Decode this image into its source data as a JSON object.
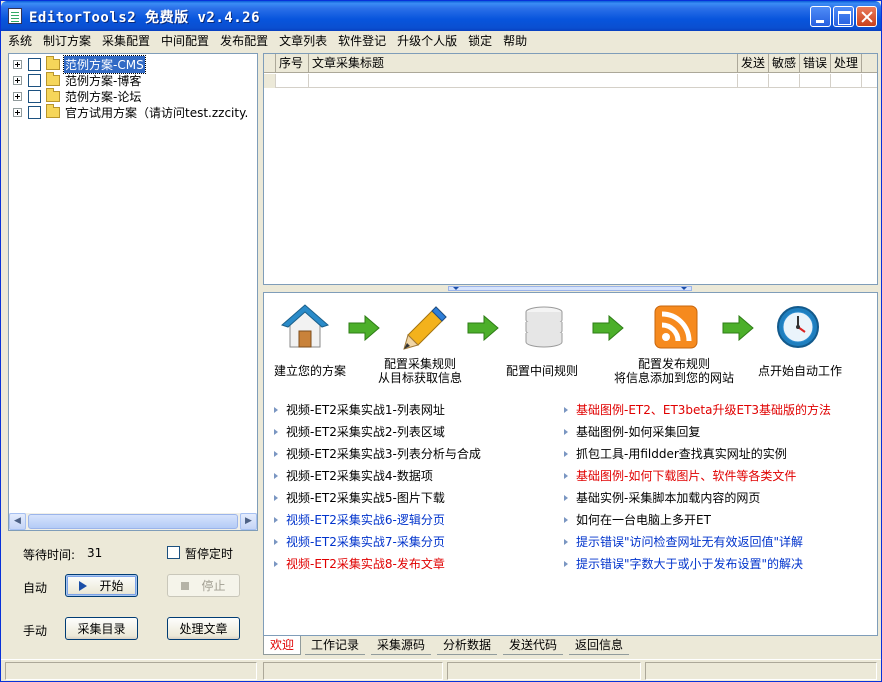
{
  "window": {
    "title": "EditorTools2 免费版 v2.4.26"
  },
  "menu": [
    "系统",
    "制订方案",
    "采集配置",
    "中间配置",
    "发布配置",
    "文章列表",
    "软件登记",
    "升级个人版",
    "锁定",
    "帮助"
  ],
  "tree": [
    {
      "label": "范例方案-CMS",
      "selected": true
    },
    {
      "label": "范例方案-博客",
      "selected": false
    },
    {
      "label": "范例方案-论坛",
      "selected": false
    },
    {
      "label": "官方试用方案（请访问test.zzcity.",
      "selected": false
    }
  ],
  "left_panel": {
    "wait_label": "等待时间:",
    "wait_value": "31",
    "pause_label": "暂停定时",
    "auto_label": "自动",
    "start_label": "开始",
    "stop_label": "停止",
    "manual_label": "手动",
    "collect_dir_label": "采集目录",
    "process_article_label": "处理文章"
  },
  "grid": {
    "columns": [
      "序号",
      "文章采集标题",
      "发送",
      "敏感",
      "错误",
      "处理"
    ]
  },
  "steps": [
    {
      "icon": "house-icon",
      "line1": "建立您的方案",
      "line2": ""
    },
    {
      "icon": "pencil-icon",
      "line1": "配置采集规则",
      "line2": "从目标获取信息"
    },
    {
      "icon": "database-icon",
      "line1": "配置中间规则",
      "line2": ""
    },
    {
      "icon": "rss-icon",
      "line1": "配置发布规则",
      "line2": "将信息添加到您的网站"
    },
    {
      "icon": "clock-icon",
      "line1": "点开始自动工作",
      "line2": ""
    }
  ],
  "links_left": [
    {
      "text": "视频-ET2采集实战1-列表网址",
      "color": "black"
    },
    {
      "text": "视频-ET2采集实战2-列表区域",
      "color": "black"
    },
    {
      "text": "视频-ET2采集实战3-列表分析与合成",
      "color": "black"
    },
    {
      "text": "视频-ET2采集实战4-数据项",
      "color": "black"
    },
    {
      "text": "视频-ET2采集实战5-图片下载",
      "color": "black"
    },
    {
      "text": "视频-ET2采集实战6-逻辑分页",
      "color": "blue"
    },
    {
      "text": "视频-ET2采集实战7-采集分页",
      "color": "blue"
    },
    {
      "text": "视频-ET2采集实战8-发布文章",
      "color": "red"
    }
  ],
  "links_right": [
    {
      "text": "基础图例-ET2、ET3beta升级ET3基础版的方法",
      "color": "red"
    },
    {
      "text": "基础图例-如何采集回复",
      "color": "black"
    },
    {
      "text": "抓包工具-用fildder查找真实网址的实例",
      "color": "black"
    },
    {
      "text": "基础图例-如何下载图片、软件等各类文件",
      "color": "red"
    },
    {
      "text": "基础实例-采集脚本加载内容的网页",
      "color": "black"
    },
    {
      "text": "如何在一台电脑上多开ET",
      "color": "black"
    },
    {
      "text": "提示错误\"访问检查网址无有效返回值\"详解",
      "color": "blue"
    },
    {
      "text": "提示错误\"字数大于或小于发布设置\"的解决",
      "color": "blue"
    }
  ],
  "tabs": [
    "欢迎",
    "工作记录",
    "采集源码",
    "分析数据",
    "发送代码",
    "返回信息"
  ],
  "colors": {
    "title_bar": "#0a55dd",
    "selection": "#316ac5",
    "link_red": "#e00000",
    "link_blue": "#0033cc",
    "arrow_green": "#4caf2a"
  }
}
